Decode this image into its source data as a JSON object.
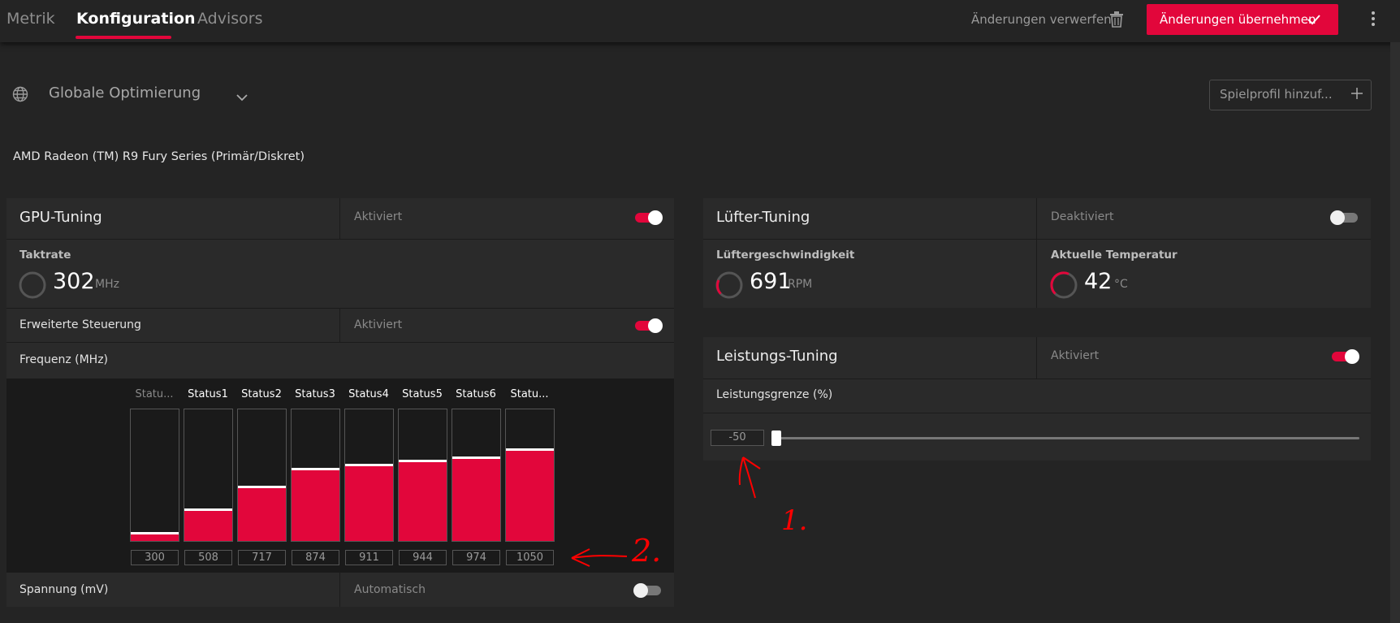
{
  "nav": {
    "tabs": [
      {
        "label": "Metrik"
      },
      {
        "label": "Konfiguration"
      },
      {
        "label": "Advisors"
      }
    ],
    "active_tab": "Konfiguration",
    "discard_label": "Änderungen verwerfen",
    "apply_label": "Änderungen übernehmen"
  },
  "profile": {
    "selected": "Globale Optimierung",
    "add_game_label": "Spielprofil hinzuf..."
  },
  "gpu_name": "AMD Radeon (TM) R9 Fury Series (Primär/Diskret)",
  "gpu_tuning": {
    "title": "GPU-Tuning",
    "status": "Aktiviert",
    "enabled": true,
    "clock_label": "Taktrate",
    "clock_value": "302",
    "clock_unit": "MHz",
    "advanced_label": "Erweiterte Steuerung",
    "advanced_status": "Aktiviert",
    "advanced_enabled": true,
    "freq_label": "Frequenz (MHz)",
    "voltage_label": "Spannung (mV)",
    "voltage_status": "Automatisch",
    "voltage_enabled": false
  },
  "chart_data": {
    "type": "bar",
    "categories": [
      "Statu...",
      "Status1",
      "Status2",
      "Status3",
      "Status4",
      "Status5",
      "Status6",
      "Statu..."
    ],
    "values": [
      300,
      508,
      717,
      874,
      911,
      944,
      974,
      1050
    ],
    "ylim": [
      240,
      1420
    ]
  },
  "fan_tuning": {
    "title": "Lüfter-Tuning",
    "status": "Deaktiviert",
    "enabled": false,
    "speed_label": "Lüftergeschwindigkeit",
    "speed_value": "691",
    "speed_unit": "RPM",
    "temp_label": "Aktuelle Temperatur",
    "temp_value": "42",
    "temp_unit": "°C"
  },
  "power_tuning": {
    "title": "Leistungs-Tuning",
    "status": "Aktiviert",
    "enabled": true,
    "limit_label": "Leistungsgrenze (%)",
    "limit_value": "-50",
    "limit_fraction": 0
  },
  "annotations": [
    "2.",
    "1."
  ],
  "colors": {
    "accent": "#e2063b",
    "background": "#242424",
    "panel": "#2a2a2a",
    "annotation": "#ff0000"
  }
}
